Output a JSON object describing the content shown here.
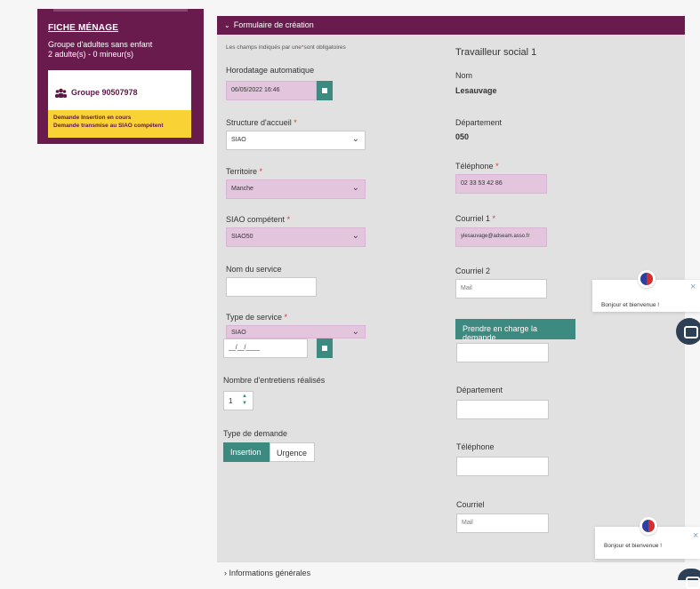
{
  "sidebar": {
    "title": "FICHE MÉNAGE",
    "subtitle1": "Groupe d'adultes sans enfant",
    "subtitle2": "2 adulte(s) - 0 mineur(s)",
    "group_label": "Groupe 90507978",
    "warning_line1": "Demande Insertion en cours",
    "warning_line2": "Demande transmise au SIAO compétent"
  },
  "form": {
    "header": "Formulaire de création",
    "required_note_a": "Les champs indiqués par une",
    "required_note_star": "*",
    "required_note_b": "sont obligatoires",
    "horodatage_label": "Horodatage automatique",
    "horodatage_value": "06/05/2022 16:46",
    "structure_label": "Structure d'accueil",
    "structure_value": "SIAO",
    "territoire_label": "Territoire",
    "territoire_value": "Manche",
    "siao_label": "SIAO compétent",
    "siao_value": "SIAO50",
    "nom_service_label": "Nom du service",
    "type_service_label": "Type de service",
    "type_service_value": "SIAO",
    "date_placeholder": "__/__/____",
    "nb_entretiens_label": "Nombre d'entretiens réalisés",
    "nb_entretiens_value": "1",
    "type_demande_label": "Type de demande",
    "type_demande_insertion": "Insertion",
    "type_demande_urgence": "Urgence",
    "required_star": "*"
  },
  "travailleur": {
    "title": "Travailleur social 1",
    "nom_label": "Nom",
    "nom_value": "Lesauvage",
    "departement_label": "Département",
    "departement_value": "050",
    "telephone_label": "Téléphone",
    "telephone_value": "02 33 53 42 86",
    "courriel1_label": "Courriel 1",
    "courriel1_value": "ylesauvage@adseam.asso.fr",
    "courriel2_label": "Courriel 2",
    "courriel2_placeholder": "Mail",
    "prendre_button": "Prendre en charge la demande",
    "departement2_label": "Département",
    "telephone2_label": "Téléphone",
    "courriel_label": "Courriel",
    "courriel_placeholder": "Mail"
  },
  "bottom_section": "Informations générales",
  "chat": {
    "greeting": "Bonjour et bienvenue !",
    "close": "×"
  },
  "colors": {
    "brand": "#6a1b4d",
    "accent": "#3d8a80",
    "warning": "#f9d236",
    "required": "#d63b3b"
  }
}
